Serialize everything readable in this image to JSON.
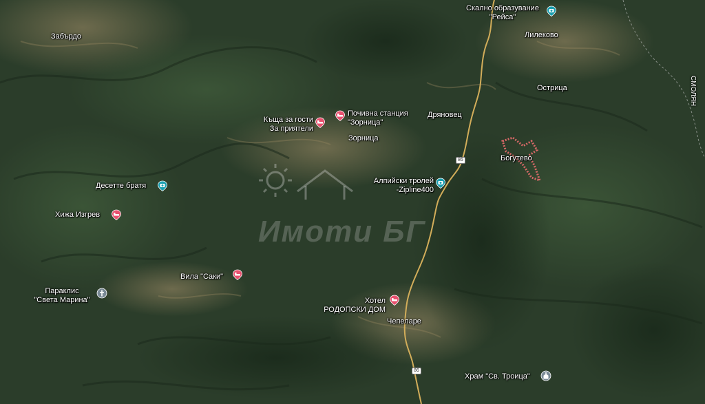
{
  "map": {
    "road_number": "86",
    "watermark": "Имоти БГ",
    "places": {
      "zabardo": "Забърдо",
      "skalno_1": "Скално образувание",
      "skalno_2": "\"Рейса\"",
      "lilekovo": "Лилеково",
      "smolyan": "СМОЛЯН",
      "ostritsa": "Острица",
      "dryanovets": "Дряновец",
      "kashta_1": "Къща за гости",
      "kashta_2": "За приятели",
      "pochivna_1": "Почивна станция",
      "pochivna_2": "\"Зорница\"",
      "zornitsa": "Зорница",
      "bogutevo": "Богутево",
      "desette": "Десетте братя",
      "troley_1": "Алпийски тролей",
      "troley_2": "-Zipline400",
      "hizha": "Хижа Изгрев",
      "vila": "Вила \"Саки\"",
      "paraklis_1": "Параклис",
      "paraklis_2": "\"Света Марина\"",
      "hotel_1": "Хотел",
      "hotel_2": "РОДОПСКИ ДОМ",
      "chepelare": "Чепеларе",
      "hram": "Храм \"Св. Троица\""
    }
  },
  "colors": {
    "lodging_pin": "#e8516f",
    "attraction_pin": "#1a9fb0",
    "worship_pin": "#7a8a96",
    "road": "#d2ad5a",
    "boundary": "#e06a6a"
  },
  "icons": {
    "lodging": "bed-icon",
    "attraction": "camera-icon",
    "worship": "cross-icon",
    "church": "church-icon"
  }
}
